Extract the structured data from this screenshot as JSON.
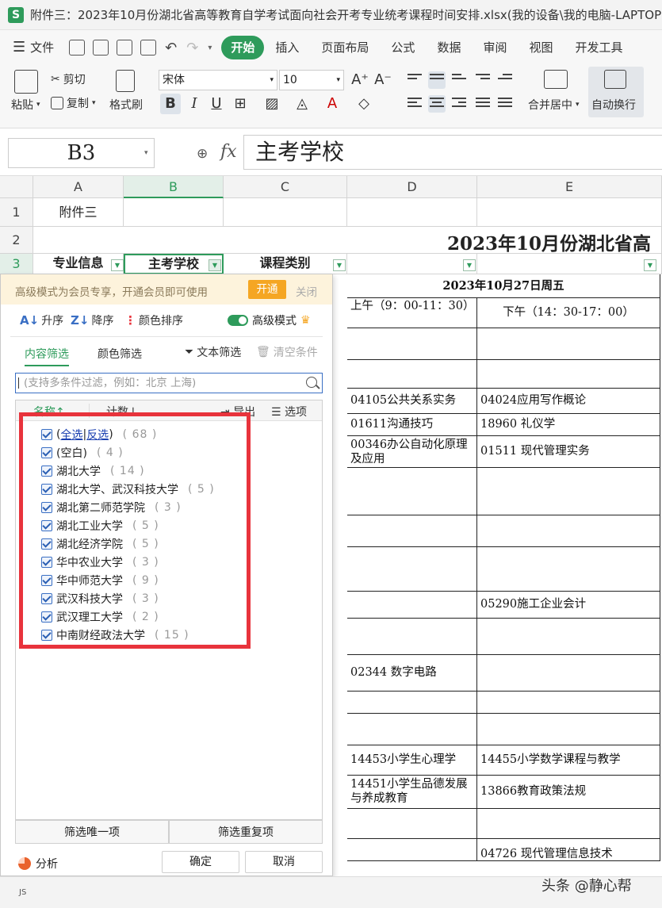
{
  "window": {
    "app_logo": "S",
    "title": "附件三：2023年10月份湖北省高等教育自学考试面向社会开考专业统考课程时间安排.xlsx(我的设备\\我的电脑-LAPTOP"
  },
  "menu": {
    "file": "文件",
    "tabs": [
      "开始",
      "插入",
      "页面布局",
      "公式",
      "数据",
      "审阅",
      "视图",
      "开发工具"
    ]
  },
  "ribbon": {
    "paste": "粘贴",
    "cut": "剪切",
    "copy": "复制",
    "format_painter": "格式刷",
    "font_name": "宋体",
    "font_size": "10",
    "merge_center": "合并居中",
    "wrap_text": "自动换行"
  },
  "formula_bar": {
    "cell_ref": "B3",
    "fx": "fx",
    "content": "主考学校"
  },
  "sheet": {
    "columns": [
      "A",
      "B",
      "C",
      "D",
      "E"
    ],
    "rows": [
      "1",
      "2",
      "3"
    ],
    "a1": "附件三",
    "title_row2": "2023年10月份湖北省高",
    "headers": {
      "major_info": "专业信息",
      "main_school": "主考学校",
      "course_type": "课程类别"
    },
    "date_header": "2023年10月27日周五",
    "morning": "上午（9：00-11：30）",
    "afternoon": "下午（14：30-17：00）",
    "courses": {
      "d_1": "04105公共关系实务",
      "e_1": "04024应用写作概论",
      "d_2": "01611沟通技巧",
      "e_2": "18960 礼仪学",
      "d_3": "00346办公自动化原理及应用",
      "e_3": "01511 现代管理实务",
      "e_4": "05290施工企业会计",
      "d_5": "02344 数字电路",
      "d_6": "14453小学生心理学",
      "e_6": "14455小学数学课程与教学",
      "d_7": "14451小学生品德发展与养成教育",
      "e_7": "13866教育政策法规",
      "e_8": "04726 现代管理信息技术"
    }
  },
  "filter_panel": {
    "promo_text": "高级模式为会员专享，开通会员即可使用",
    "promo_open": "开通",
    "promo_close": "关闭",
    "sort_asc": "升序",
    "sort_desc": "降序",
    "color_sort": "颜色排序",
    "advanced_mode": "高级模式",
    "tab_content": "内容筛选",
    "tab_color": "颜色筛选",
    "text_filter": "文本筛选",
    "clear_conditions": "清空条件",
    "search_placeholder": "(支持多条件过滤，例如：北京  上海)",
    "col_name": "名称↑",
    "col_count": "计数↓",
    "export": "导出",
    "options": "选项",
    "select_all": "全选",
    "invert": "反选",
    "select_all_count": "( 68 )",
    "items": [
      {
        "label": "(空白)",
        "count": "( 4 )"
      },
      {
        "label": "湖北大学",
        "count": "( 14 )"
      },
      {
        "label": "湖北大学、武汉科技大学",
        "count": "( 5 )"
      },
      {
        "label": "湖北第二师范学院",
        "count": "( 3 )"
      },
      {
        "label": "湖北工业大学",
        "count": "( 5 )"
      },
      {
        "label": "湖北经济学院",
        "count": "( 5 )"
      },
      {
        "label": "华中农业大学",
        "count": "( 3 )"
      },
      {
        "label": "华中师范大学",
        "count": "( 9 )"
      },
      {
        "label": "武汉科技大学",
        "count": "( 3 )"
      },
      {
        "label": "武汉理工大学",
        "count": "( 2 )"
      },
      {
        "label": "中南财经政法大学",
        "count": "( 15 )"
      }
    ],
    "filter_unique": "筛选唯一项",
    "filter_duplicate": "筛选重复项",
    "analysis": "分析",
    "ok": "确定",
    "cancel": "取消"
  },
  "watermark": "头条 @静心帮",
  "status_tag": "JS"
}
